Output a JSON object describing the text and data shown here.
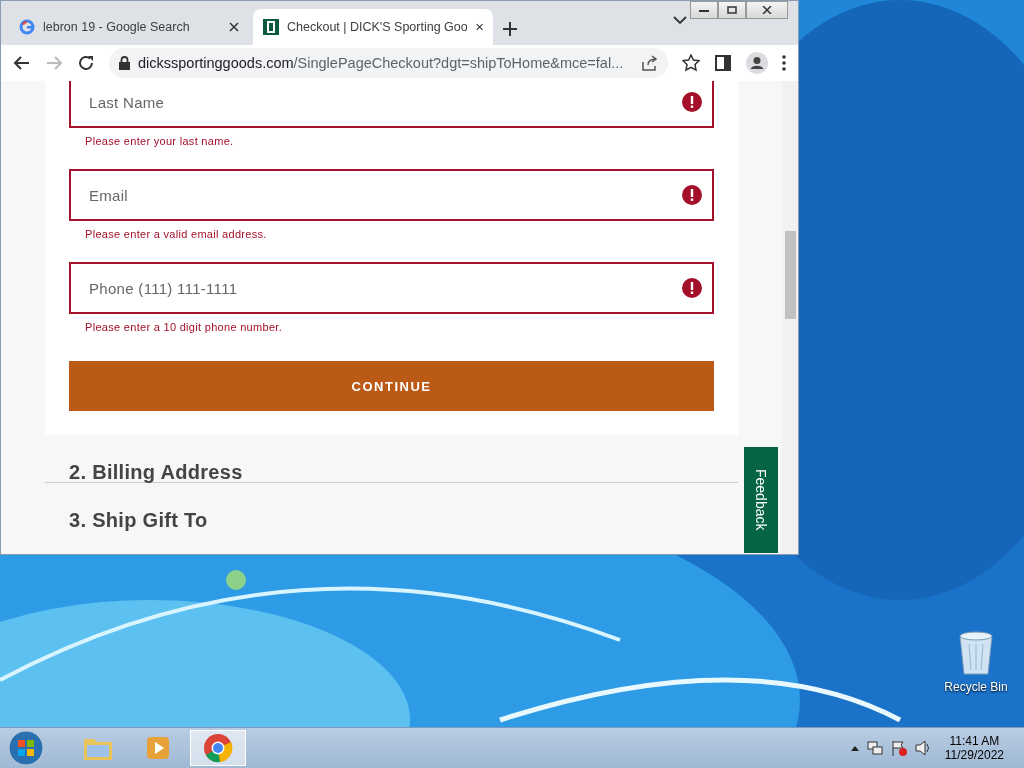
{
  "tabs": [
    {
      "title": "lebron 19 - Google Search",
      "selected": false,
      "kind": "google"
    },
    {
      "title": "Checkout | DICK'S Sporting Goo",
      "selected": true,
      "kind": "dicks"
    }
  ],
  "address": {
    "domain": "dickssportinggoods.com",
    "path": "/SinglePageCheckout?dgt=shipToHome&mce=fal..."
  },
  "form": {
    "fields": [
      {
        "placeholder": "Last Name",
        "error": "Please enter your last name.",
        "invalid": true
      },
      {
        "placeholder": "Email",
        "error": "Please enter a valid email address.",
        "invalid": true
      },
      {
        "placeholder": "Phone (111) 111-1111",
        "error": "Please enter a 10 digit phone number.",
        "invalid": true
      }
    ],
    "button": "CONTINUE"
  },
  "sections": [
    {
      "title": "2. Billing Address"
    },
    {
      "title": "3. Ship Gift To"
    }
  ],
  "feedback": "Feedback",
  "desktop_icons": [
    {
      "label": "Recycle Bin"
    }
  ],
  "taskbar": {
    "apps": [
      {
        "kind": "explorer",
        "selected": false
      },
      {
        "kind": "media",
        "selected": false
      },
      {
        "kind": "chrome",
        "selected": true
      }
    ],
    "time": "11:41 AM",
    "date": "11/29/2022"
  }
}
